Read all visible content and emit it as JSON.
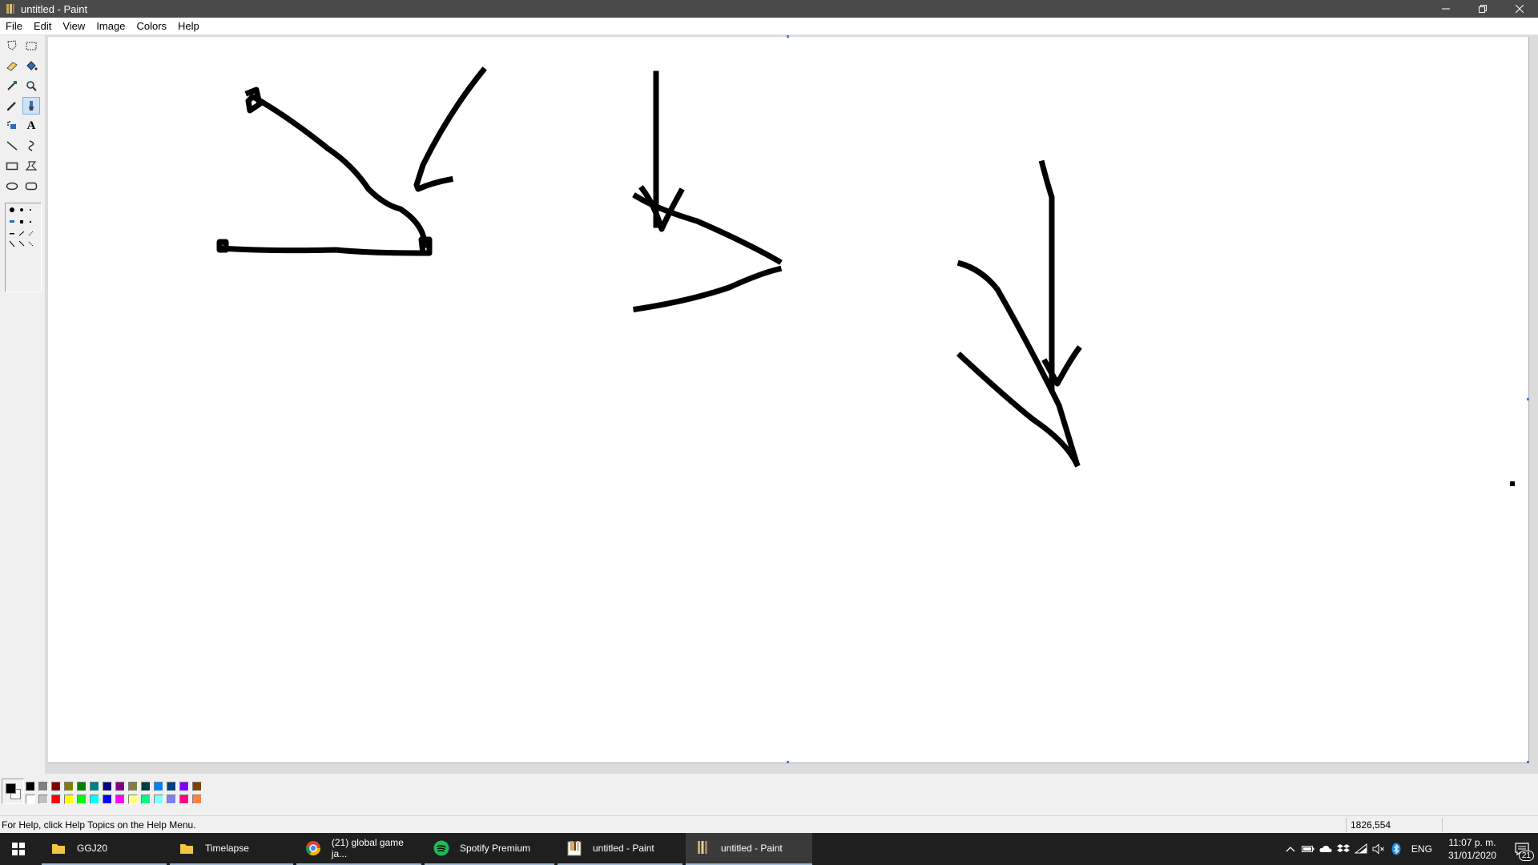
{
  "window": {
    "title": "untitled - Paint"
  },
  "menubar": {
    "items": [
      "File",
      "Edit",
      "View",
      "Image",
      "Colors",
      "Help"
    ]
  },
  "toolbox": {
    "tools": [
      {
        "name": "free-form-select-icon"
      },
      {
        "name": "select-icon"
      },
      {
        "name": "eraser-icon"
      },
      {
        "name": "fill-with-color-icon"
      },
      {
        "name": "pick-color-icon"
      },
      {
        "name": "magnifier-icon"
      },
      {
        "name": "pencil-icon"
      },
      {
        "name": "brush-icon",
        "active": true
      },
      {
        "name": "airbrush-icon"
      },
      {
        "name": "text-icon",
        "glyph": "A"
      },
      {
        "name": "line-icon"
      },
      {
        "name": "curve-icon"
      },
      {
        "name": "rectangle-icon"
      },
      {
        "name": "polygon-icon"
      },
      {
        "name": "ellipse-icon"
      },
      {
        "name": "rounded-rectangle-icon"
      }
    ]
  },
  "palette": {
    "foreground": "#000000",
    "background": "#ffffff",
    "top_row": [
      "#000000",
      "#808080",
      "#800000",
      "#808000",
      "#008000",
      "#008080",
      "#000080",
      "#800080",
      "#808040",
      "#004040",
      "#0080ff",
      "#004080",
      "#8000ff",
      "#804000"
    ],
    "bottom_row": [
      "#ffffff",
      "#c0c0c0",
      "#ff0000",
      "#ffff00",
      "#00ff00",
      "#00ffff",
      "#0000ff",
      "#ff00ff",
      "#ffff80",
      "#00ff80",
      "#80ffff",
      "#8080ff",
      "#ff0080",
      "#ff8040"
    ]
  },
  "statusbar": {
    "help_text": "For Help, click Help Topics on the Help Menu.",
    "coordinates": "1826,554"
  },
  "taskbar": {
    "items": [
      {
        "label": "GGJ20",
        "icon": "folder-icon"
      },
      {
        "label": "Timelapse",
        "icon": "folder-icon"
      },
      {
        "label": "(21) global game ja...",
        "icon": "chrome-icon"
      },
      {
        "label": "Spotify Premium",
        "icon": "spotify-icon"
      },
      {
        "label": "untitled - Paint",
        "icon": "paint-icon"
      },
      {
        "label": "untitled - Paint",
        "icon": "paint-icon",
        "active": true
      }
    ],
    "tray": {
      "language": "ENG",
      "time": "11:07 p. m.",
      "date": "31/01/2020",
      "notification_count": "21"
    }
  }
}
